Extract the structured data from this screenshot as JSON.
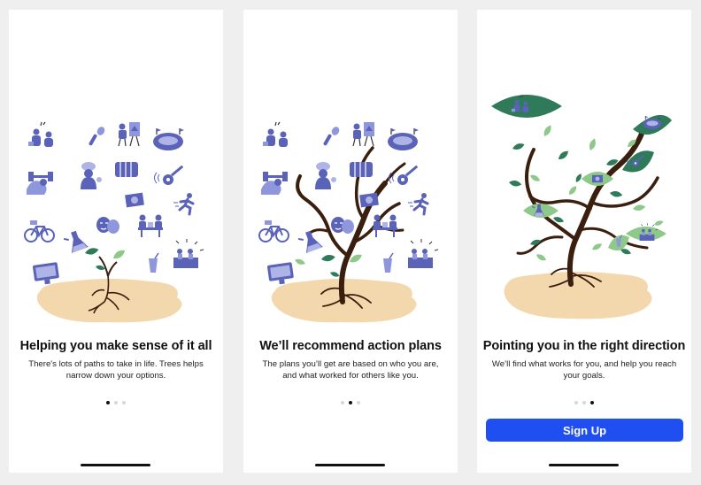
{
  "colors": {
    "accent": "#1f4ff0",
    "icon_blue": "#5a63b8",
    "leaf_green": "#2f7a58",
    "soil": "#f3d7ad",
    "trunk": "#3b1f0e"
  },
  "screens": [
    {
      "title": "Helping you make sense of it all",
      "subtitle": "There's lots of paths to take in life. Trees helps narrow down your options.",
      "active_dot": 0
    },
    {
      "title": "We’ll recommend action plans",
      "subtitle": "The plans you’ll get are based on who you are, and what worked for others like you.",
      "active_dot": 1
    },
    {
      "title": "Pointing you in the right direction",
      "subtitle": "We’ll find what works for you, and help you reach your goals.",
      "active_dot": 2
    }
  ],
  "signup_label": "Sign Up",
  "icons": [
    "people-icon",
    "microphone-icon",
    "painter-icon",
    "stadium-icon",
    "weightlifter-icon",
    "chef-icon",
    "accordion-icon",
    "guitar-icon",
    "reading-icon",
    "camera-icon",
    "runner-icon",
    "bicycle-icon",
    "science-icon",
    "theater-masks-icon",
    "study-icon",
    "computer-icon",
    "drink-icon",
    "orchestra-icon"
  ]
}
